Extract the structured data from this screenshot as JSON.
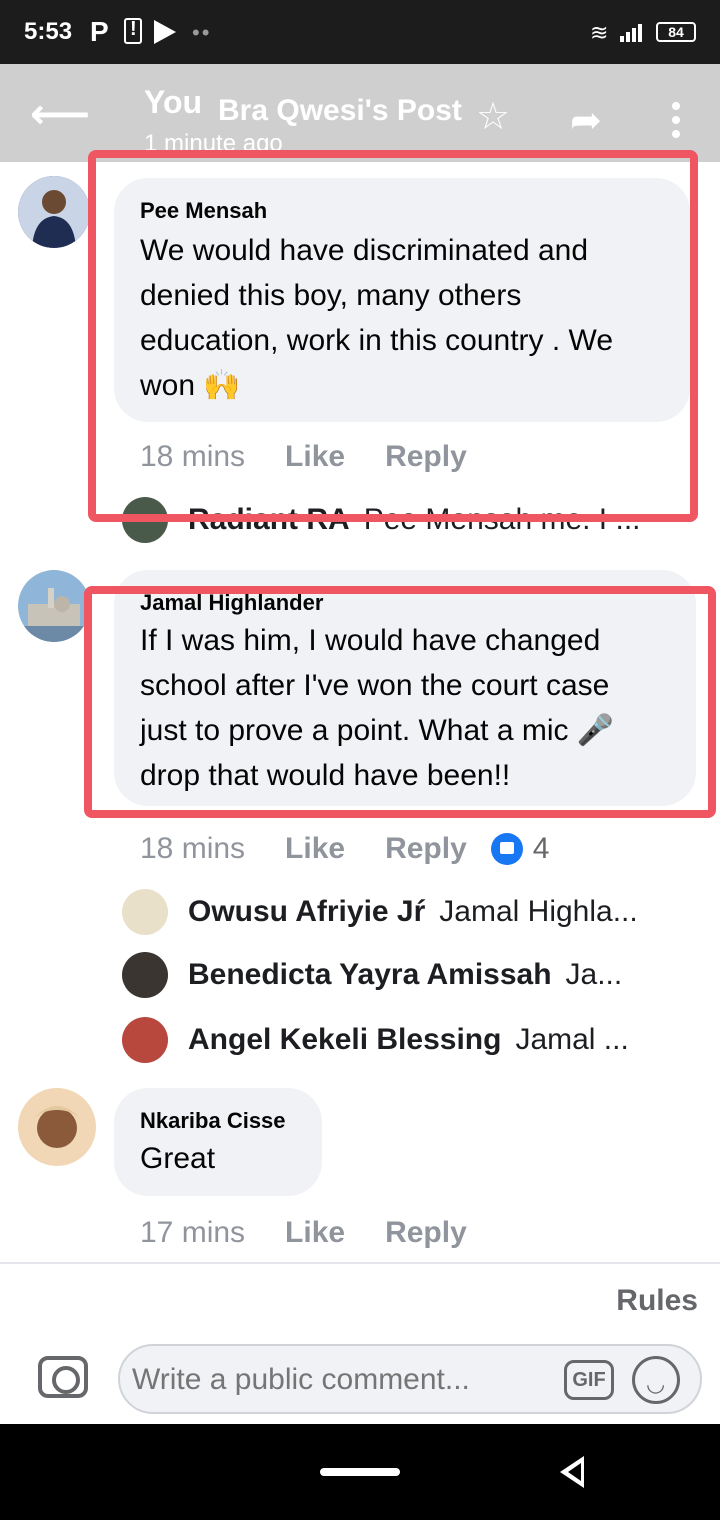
{
  "status_bar": {
    "time": "5:53",
    "battery": "84"
  },
  "header": {
    "you": "You",
    "title": "Bra Qwesi's Post",
    "subtitle": "1 minute ago"
  },
  "comments": [
    {
      "name": "Pee Mensah",
      "lines": [
        "We would have discriminated and",
        "denied this boy, many others",
        "education, work in this country . We",
        "won 🙌"
      ],
      "time": "18 mins",
      "like": "Like",
      "reply": "Reply"
    },
    {
      "name": "Jamal Highlander",
      "lines": [
        "If I was him, I would have changed",
        "school after I've won the court case",
        "just to prove a point. What a mic 🎤",
        "drop that would have been!!"
      ],
      "time": "18 mins",
      "like": "Like",
      "reply": "Reply",
      "reactions": "4"
    },
    {
      "name": "Nkariba Cisse",
      "lines": [
        "Great"
      ],
      "time": "17 mins",
      "like": "Like",
      "reply": "Reply"
    }
  ],
  "replies_pee": [
    {
      "name": "Radiant RA",
      "text": "Pee Mensah me. I ..."
    }
  ],
  "replies_jamal": [
    {
      "name": "Owusu Afriyie Jŕ",
      "text": "Jamal Highla..."
    },
    {
      "name": "Benedicta Yayra Amissah",
      "text": "Ja..."
    },
    {
      "name": "Angel Kekeli Blessing",
      "text": "Jamal ..."
    }
  ],
  "composer": {
    "rules": "Rules",
    "placeholder": "Write a public comment...",
    "gif": "GIF"
  },
  "colors": {
    "highlight": "#ef5662",
    "bubble": "#f0f2f5",
    "accent": "#1877f2"
  },
  "icons": [
    "back-arrow-icon",
    "star-icon",
    "share-icon",
    "more-icon",
    "camera-icon",
    "gif-icon",
    "emoji-icon",
    "like-reaction-icon"
  ]
}
